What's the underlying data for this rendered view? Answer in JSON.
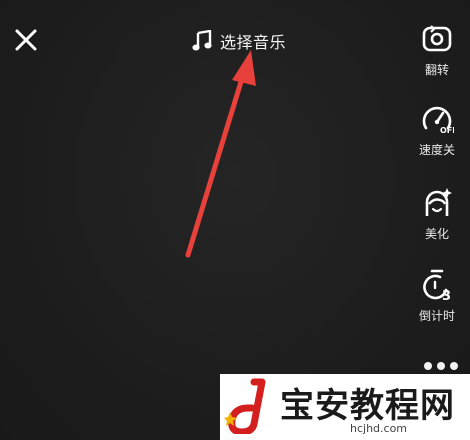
{
  "top_bar": {
    "close_icon": "close-icon",
    "music_icon": "music-note-icon",
    "select_music_label": "选择音乐"
  },
  "side_tools": [
    {
      "name": "flip",
      "icon": "flip-camera-icon",
      "label": "翻转"
    },
    {
      "name": "speed",
      "icon": "speed-off-icon",
      "label": "速度关"
    },
    {
      "name": "beauty",
      "icon": "beauty-face-icon",
      "label": "美化"
    },
    {
      "name": "timer",
      "icon": "timer-3s-icon",
      "label": "倒计时"
    }
  ],
  "more_icon": "more-dots-icon",
  "annotation": {
    "color": "#e8403a"
  },
  "watermark": {
    "title": "宝安教程网",
    "url": "hcjhd.com",
    "accent": "#d41f1f"
  }
}
